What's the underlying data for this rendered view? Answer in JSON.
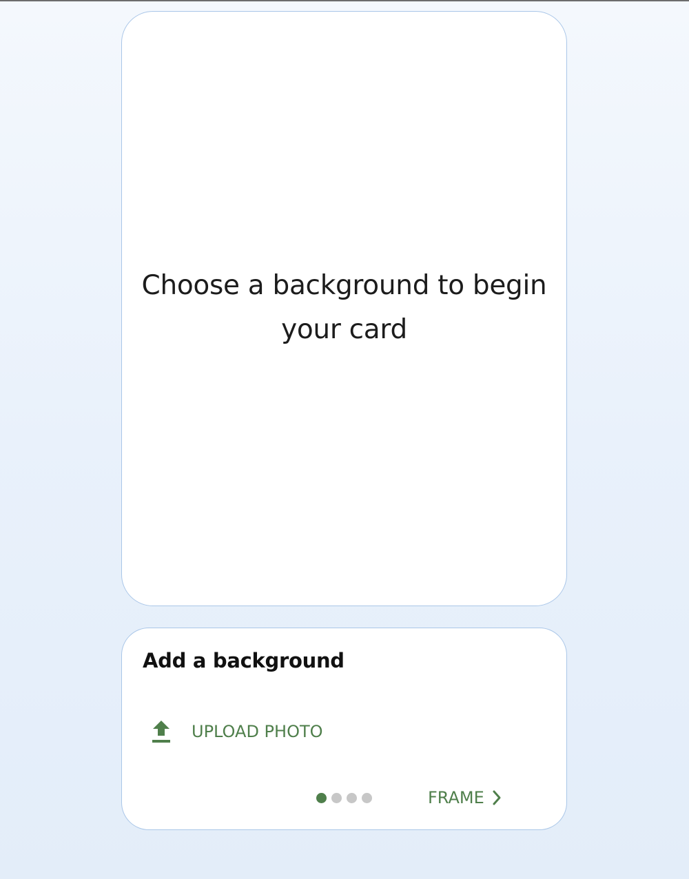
{
  "preview": {
    "message": "Choose a background to begin your card"
  },
  "panel": {
    "title": "Add a background",
    "upload": {
      "label": "UPLOAD PHOTO",
      "icon": "upload-icon"
    },
    "steps": {
      "total": 4,
      "current": 1
    },
    "next": {
      "label": "FRAME",
      "icon": "chevron-right-icon"
    }
  },
  "colors": {
    "accent": "#4f7f4b",
    "card_border": "#a9c6e8",
    "inactive_dot": "#c7c7c7"
  }
}
